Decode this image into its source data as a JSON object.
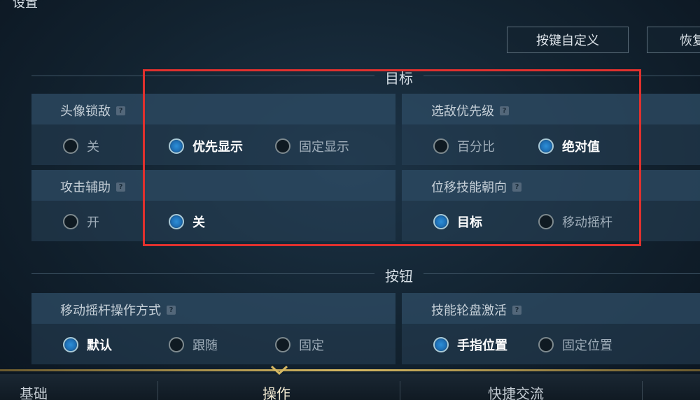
{
  "header": {
    "title": "设置",
    "buttons": {
      "custom_keys": "按键自定义",
      "restore": "恢复"
    }
  },
  "sections": {
    "target": {
      "title": "目标",
      "avatar_lock": {
        "label": "头像锁敌",
        "options": [
          "关",
          "优先显示",
          "固定显示"
        ],
        "selected": "优先显示"
      },
      "enemy_priority": {
        "label": "选敌优先级",
        "options": [
          "百分比",
          "绝对值"
        ],
        "selected": "绝对值"
      },
      "attack_assist": {
        "label": "攻击辅助",
        "options": [
          "开",
          "关"
        ],
        "selected": "关"
      },
      "skill_direction": {
        "label": "位移技能朝向",
        "options": [
          "目标",
          "移动摇杆"
        ],
        "selected": "目标"
      }
    },
    "buttons": {
      "title": "按钮",
      "joystick_mode": {
        "label": "移动摇杆操作方式",
        "options": [
          "默认",
          "跟随",
          "固定"
        ],
        "selected": "默认"
      },
      "skill_wheel": {
        "label": "技能轮盘激活",
        "options": [
          "手指位置",
          "固定位置"
        ],
        "selected": "手指位置"
      }
    }
  },
  "tabs": [
    {
      "label": "基础",
      "active": false
    },
    {
      "label": "操作",
      "active": true
    },
    {
      "label": "快捷交流",
      "active": false
    }
  ],
  "help_glyph": "?",
  "colors": {
    "accent_gold": "#d6b862",
    "selection_blue": "#2d8fd8",
    "highlight_red": "#e0312e"
  }
}
